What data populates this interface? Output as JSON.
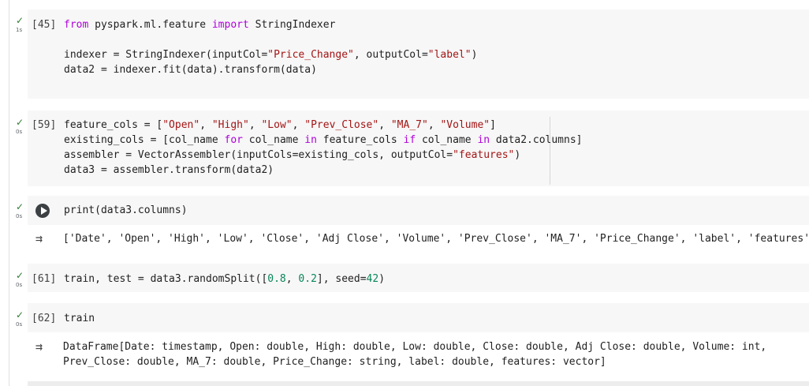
{
  "cells": [
    {
      "exec_count": "[45]",
      "time": "1s",
      "lines": [
        [
          "from",
          " pyspark.ml.feature ",
          "import",
          " StringIndexer"
        ],
        [],
        [
          "indexer = StringIndexer(inputCol=",
          "\"Price_Change\"",
          ", outputCol=",
          "\"label\"",
          ")"
        ],
        [
          "data2 = indexer.fit(data).transform(data)"
        ]
      ]
    },
    {
      "exec_count": "[59]",
      "time": "0s",
      "lines": [
        [
          "feature_cols = [",
          "\"Open\"",
          ", ",
          "\"High\"",
          ", ",
          "\"Low\"",
          ", ",
          "\"Prev_Close\"",
          ", ",
          "\"MA_7\"",
          ", ",
          "\"Volume\"",
          "]"
        ],
        [
          "existing_cols = [col_name ",
          "for",
          " col_name ",
          "in",
          " feature_cols ",
          "if",
          " col_name ",
          "in",
          " data2.columns]"
        ],
        [
          "assembler = VectorAssembler(inputCols=existing_cols, outputCol=",
          "\"features\"",
          ")"
        ],
        [
          "data3 = assembler.transform(data2)"
        ]
      ]
    },
    {
      "exec_count": "",
      "time": "0s",
      "lines": [
        [
          "print(data3.columns)"
        ]
      ],
      "output": [
        "['Date', 'Open', 'High', 'Low', 'Close', 'Adj Close', 'Volume', 'Prev_Close', 'MA_7', 'Price_Change', 'label', 'features']"
      ]
    },
    {
      "exec_count": "[61]",
      "time": "0s",
      "lines": [
        [
          "train, test = data3.randomSplit([",
          "0.8",
          ", ",
          "0.2",
          "], seed=",
          "42",
          ")"
        ]
      ]
    },
    {
      "exec_count": "[62]",
      "time": "0s",
      "lines": [
        [
          "train"
        ]
      ],
      "output": [
        "DataFrame[Date: timestamp, Open: double, High: double, Low: double, Close: double, Adj Close: double, Volume: int,",
        "Prev_Close: double, MA_7: double, Price_Change: string, label: double, features: vector]"
      ]
    }
  ],
  "icons": {
    "check": "check-icon",
    "run": "play-run-icon",
    "output": "output-toggle-icon"
  },
  "colors": {
    "check": "#2e7d32",
    "keyword": "#af00db",
    "string": "#a31515",
    "number": "#098658",
    "cell_bg": "#f7f7f7"
  }
}
